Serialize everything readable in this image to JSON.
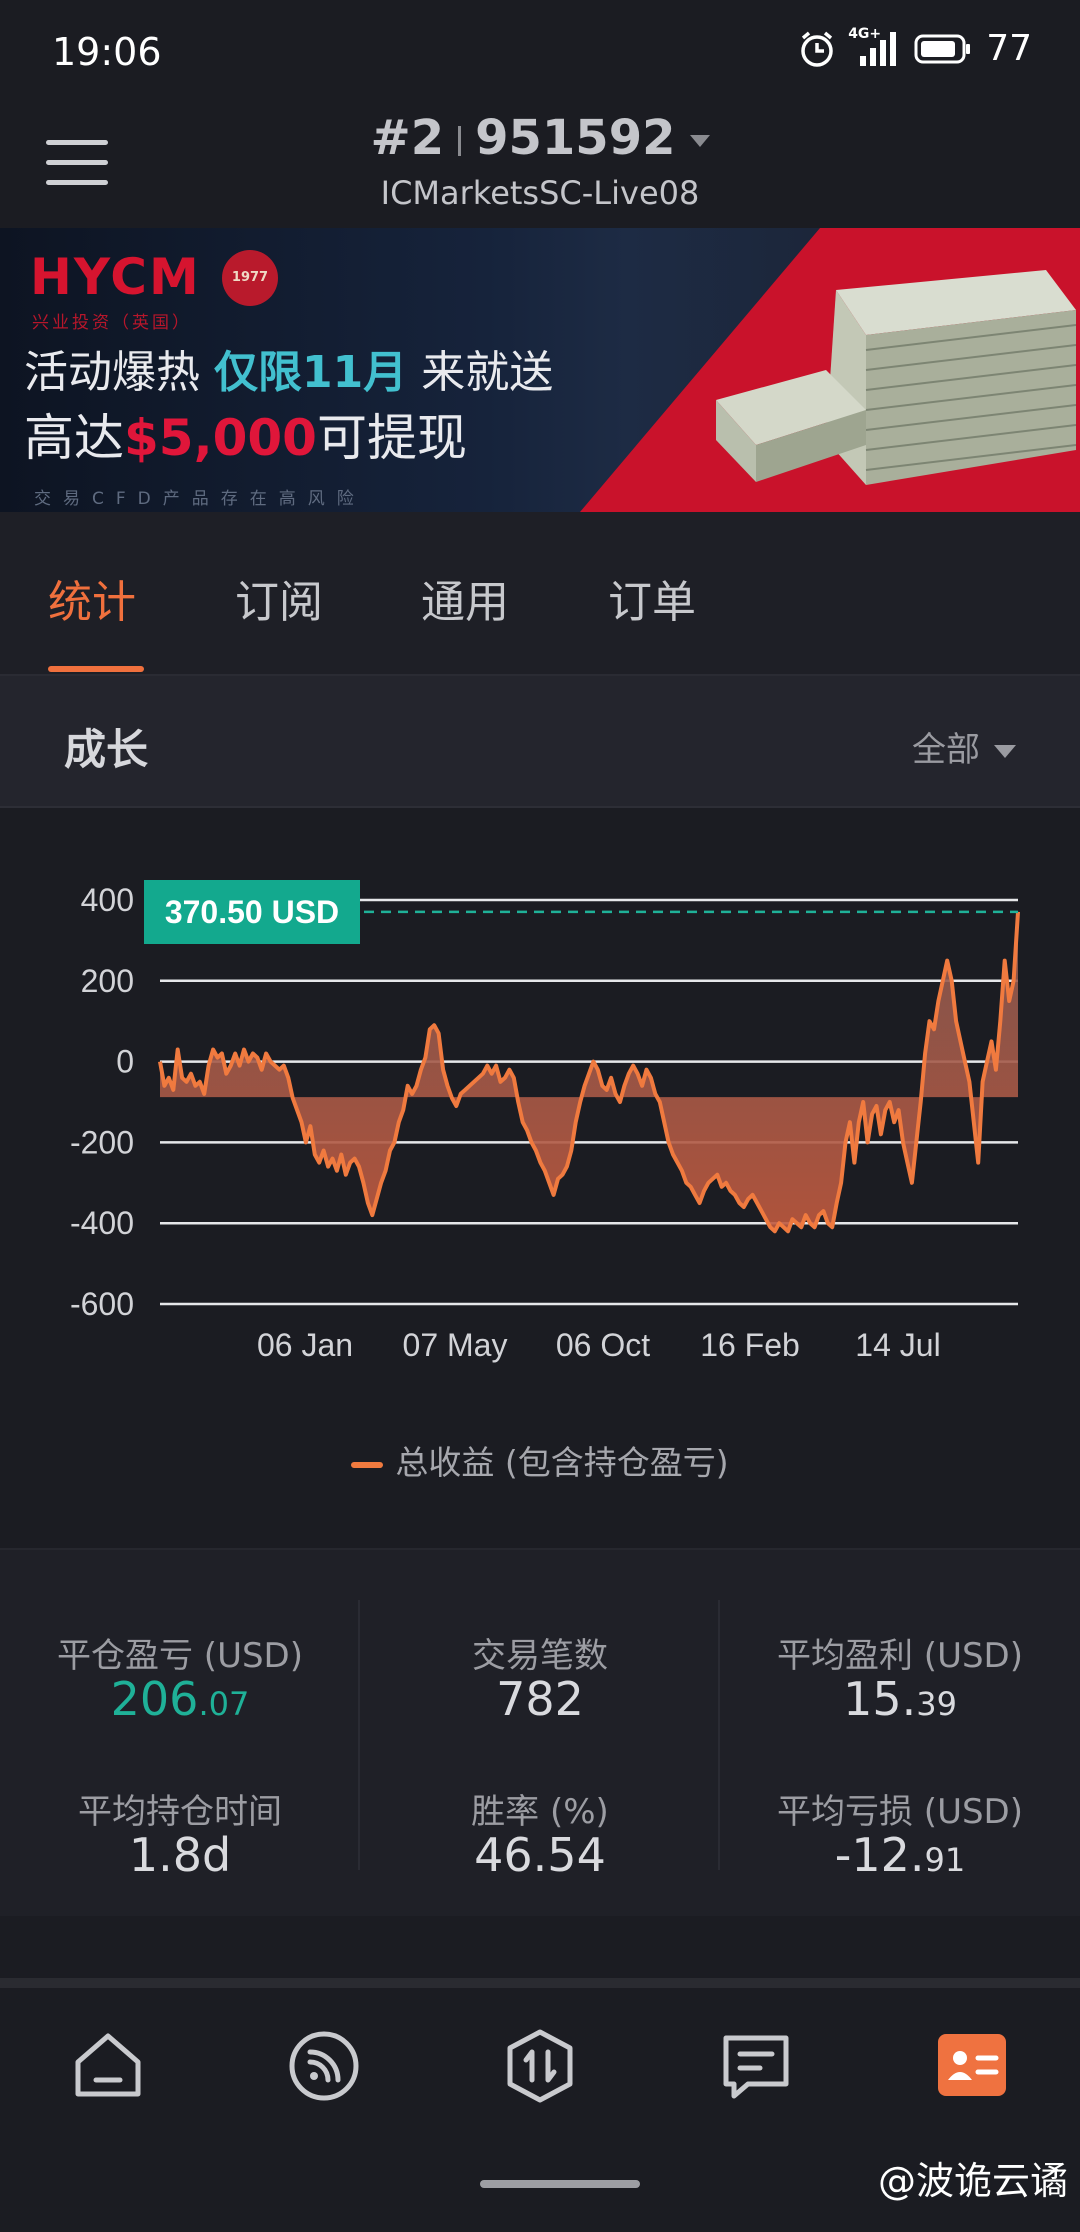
{
  "status_bar": {
    "time": "19:06",
    "network": "4G+",
    "battery": "77"
  },
  "header": {
    "account_index": "#2",
    "account_number": "951592",
    "server": "ICMarketsSC-Live08"
  },
  "banner": {
    "logo": "HYCM",
    "logo_sub": "兴业投资（英国）",
    "seal": "1977",
    "line1_a": "活动爆热 ",
    "line1_highlight": "仅限11月",
    "line1_b": " 来就送",
    "line2_a": "高达",
    "line2_amount": "$5,000",
    "line2_b": "可提现",
    "risk": "交易CFD产品存在高风险"
  },
  "tabs": [
    {
      "label": "统计",
      "active": true
    },
    {
      "label": "订阅",
      "active": false
    },
    {
      "label": "通用",
      "active": false
    },
    {
      "label": "订单",
      "active": false
    }
  ],
  "growth": {
    "title": "成长",
    "filter": "全部"
  },
  "chart_data": {
    "type": "line",
    "current_value_label": "370.50 USD",
    "current_value": 370.5,
    "yticks": [
      "400",
      "200",
      "0",
      "-200",
      "-400",
      "-600"
    ],
    "ylim": [
      -600,
      400
    ],
    "xticks": [
      "06 Jan",
      "07 May",
      "06 Oct",
      "16 Feb",
      "14 Jul"
    ],
    "legend": "总收益 (包含持仓盈亏)",
    "series": [
      {
        "name": "总收益 (包含持仓盈亏)",
        "values": [
          0,
          -60,
          -40,
          -70,
          30,
          -40,
          -50,
          -30,
          -60,
          -50,
          -80,
          -10,
          30,
          10,
          20,
          -30,
          -10,
          20,
          -10,
          30,
          0,
          20,
          10,
          -20,
          20,
          0,
          -10,
          -20,
          -10,
          -40,
          -90,
          -120,
          -150,
          -200,
          -160,
          -230,
          -250,
          -220,
          -260,
          -240,
          -270,
          -230,
          -280,
          -250,
          -240,
          -260,
          -300,
          -350,
          -380,
          -340,
          -300,
          -270,
          -220,
          -200,
          -150,
          -120,
          -60,
          -80,
          -60,
          -20,
          10,
          80,
          90,
          70,
          -20,
          -60,
          -90,
          -110,
          -80,
          -70,
          -60,
          -50,
          -40,
          -30,
          -10,
          -30,
          -10,
          -50,
          -40,
          -20,
          -40,
          -100,
          -150,
          -170,
          -200,
          -220,
          -250,
          -270,
          -300,
          -330,
          -290,
          -280,
          -260,
          -220,
          -150,
          -100,
          -60,
          -30,
          0,
          -20,
          -60,
          -70,
          -40,
          -80,
          -100,
          -60,
          -30,
          -10,
          -30,
          -60,
          -20,
          -40,
          -80,
          -100,
          -150,
          -200,
          -230,
          -250,
          -270,
          -300,
          -310,
          -330,
          -350,
          -320,
          -300,
          -290,
          -280,
          -310,
          -300,
          -320,
          -330,
          -350,
          -360,
          -340,
          -330,
          -350,
          -370,
          -390,
          -410,
          -420,
          -400,
          -410,
          -420,
          -390,
          -400,
          -410,
          -380,
          -400,
          -410,
          -380,
          -370,
          -400,
          -410,
          -350,
          -300,
          -200,
          -150,
          -250,
          -150,
          -100,
          -200,
          -130,
          -110,
          -180,
          -120,
          -100,
          -150,
          -120,
          -200,
          -250,
          -300,
          -200,
          -100,
          20,
          100,
          80,
          150,
          200,
          250,
          200,
          100,
          50,
          0,
          -50,
          -150,
          -250,
          -50,
          0,
          50,
          -20,
          100,
          250,
          150,
          200,
          370.5
        ]
      }
    ]
  },
  "stats": [
    {
      "label": "平仓盈亏 (USD)",
      "int": "206",
      "frac": ".07",
      "color": "#1fb198"
    },
    {
      "label": "交易笔数",
      "int": "782",
      "frac": "",
      "color": ""
    },
    {
      "label": "平均盈利 (USD)",
      "int": "15.",
      "frac": "39",
      "color": ""
    },
    {
      "label": "平均持仓时间",
      "int": "1.8d",
      "frac": "",
      "color": ""
    },
    {
      "label": "胜率 (%)",
      "int": "46.54",
      "frac": "",
      "color": ""
    },
    {
      "label": "平均亏损 (USD)",
      "int": "-12.",
      "frac": "91",
      "color": ""
    }
  ],
  "bottom_nav": [
    "home-icon",
    "feed-icon",
    "trade-icon",
    "news-icon",
    "profile-icon"
  ],
  "watermark": "@波诡云谲",
  "colors": {
    "accent": "#f0703d",
    "positive": "#1fb198",
    "line": "#f07a3f",
    "background": "#1b1c22"
  }
}
